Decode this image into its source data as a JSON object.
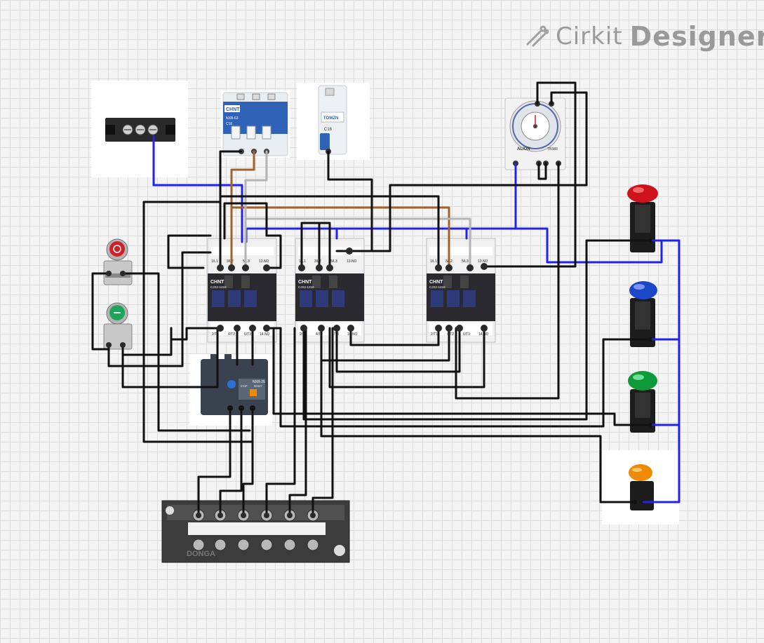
{
  "logo": {
    "text_light": "Cirkit",
    "text_bold": "Designer"
  },
  "contactors": [
    {
      "brand": "CHNT",
      "model": "CJX2-1210",
      "top_terms": [
        "1/L1",
        "3/L2",
        "5/L3",
        "13.NO"
      ],
      "bottom_terms": [
        "2/T1",
        "4/T2",
        "6/T3",
        "14.NO"
      ]
    },
    {
      "brand": "CHNT",
      "model": "CJX2-1210",
      "top_terms": [
        "1/L1",
        "3/L2",
        "5/L3",
        "13.NO"
      ],
      "bottom_terms": [
        "2/T1",
        "4/T2",
        "6/T3",
        "14.NO"
      ]
    },
    {
      "brand": "CHNT",
      "model": "CJX2-1210",
      "top_terms": [
        "1/L1",
        "3/L2",
        "5/L3",
        "13.NO"
      ],
      "bottom_terms": [
        "2/T1",
        "4/T2",
        "6/T3",
        "14.NO"
      ]
    }
  ],
  "breaker3p": {
    "brand": "CHNT",
    "model": "NXB-63",
    "rating": "C16"
  },
  "breaker1p": {
    "brand": "TOMZN",
    "rating": "C16"
  },
  "timer": {
    "brand": "ALION",
    "model": "TB388"
  },
  "overload_relay": {
    "model": "NXR-25",
    "labels": [
      "STOP",
      "RESET"
    ]
  },
  "terminal_strip": {
    "brand": "DONGA"
  },
  "pilot_lights": [
    {
      "color": "red",
      "hex": "#d0121b"
    },
    {
      "color": "blue",
      "hex": "#1a48c8"
    },
    {
      "color": "green",
      "hex": "#0f9a3a"
    },
    {
      "color": "orange",
      "hex": "#f08a00"
    }
  ],
  "pushbuttons": [
    {
      "color": "red",
      "hex": "#d0202a",
      "icon": "circle"
    },
    {
      "color": "green",
      "hex": "#1fa55a",
      "icon": "line"
    }
  ],
  "wire_colors": {
    "black": "#111111",
    "blue": "#2222ee",
    "brown": "#a0622a",
    "gray": "#b4b4b4"
  }
}
